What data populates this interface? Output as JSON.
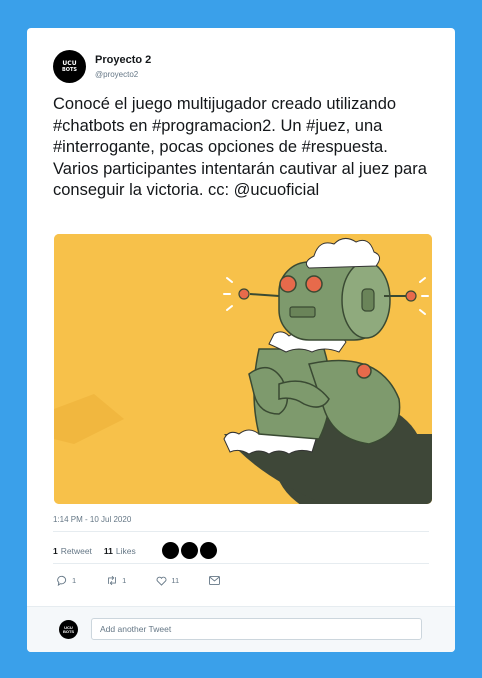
{
  "tweet": {
    "display_name": "Proyecto 2",
    "handle": "@proyecto2",
    "avatar_text_1": "UCU",
    "avatar_text_2": "BOTS",
    "text": "Conocé el juego multijugador creado utilizando #chatbots en #programacion2. Un #juez, una #interrogante, pocas opciones de #respuesta. Varios participantes intentarán cautivar al juez para conseguir la victoria. cc: @ucuoficial",
    "timestamp": "1:14 PM - 10 Jul 2020",
    "retweets_count": "1",
    "retweets_label": "Retweet",
    "likes_count": "11",
    "likes_label": "Likes"
  },
  "actions": {
    "reply_count": "1",
    "retweet_count": "1",
    "like_count": "11"
  },
  "reply": {
    "placeholder": "Add another Tweet"
  },
  "colors": {
    "background": "#3aa0ea",
    "media_background": "#f7c14a",
    "robot_green": "#7e9a6d"
  }
}
